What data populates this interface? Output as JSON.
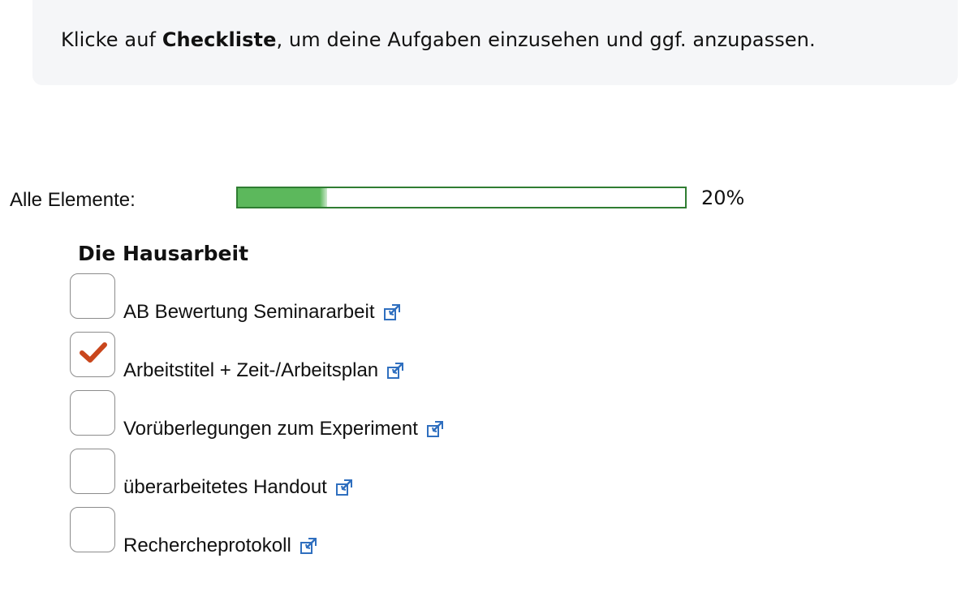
{
  "info": {
    "prefix": "Klicke auf ",
    "strong": "Checkliste",
    "suffix": ", um deine Aufgaben einzusehen und ggf. anzupassen."
  },
  "progress": {
    "label": "Alle Elemente:",
    "value_text": "20%",
    "fraction": 0.2,
    "bar_color": "#5cb85c",
    "border_color": "#2f7d32"
  },
  "section": {
    "title": "Die Hausarbeit"
  },
  "checklist": {
    "items": [
      {
        "label": "AB Bewertung Seminararbeit",
        "checked": false,
        "link_icon": "external-link-icon"
      },
      {
        "label": "Arbeitstitel + Zeit-/Arbeitsplan",
        "checked": true,
        "link_icon": "external-link-icon"
      },
      {
        "label": "Vorüberlegungen zum Experiment",
        "checked": false,
        "link_icon": "external-link-icon"
      },
      {
        "label": "überarbeitetes Handout",
        "checked": false,
        "link_icon": "external-link-icon"
      },
      {
        "label": "Rechercheprotokoll",
        "checked": false,
        "link_icon": "external-link-icon"
      }
    ],
    "check_color": "#c9461c",
    "icon_color": "#2f6fbf"
  }
}
